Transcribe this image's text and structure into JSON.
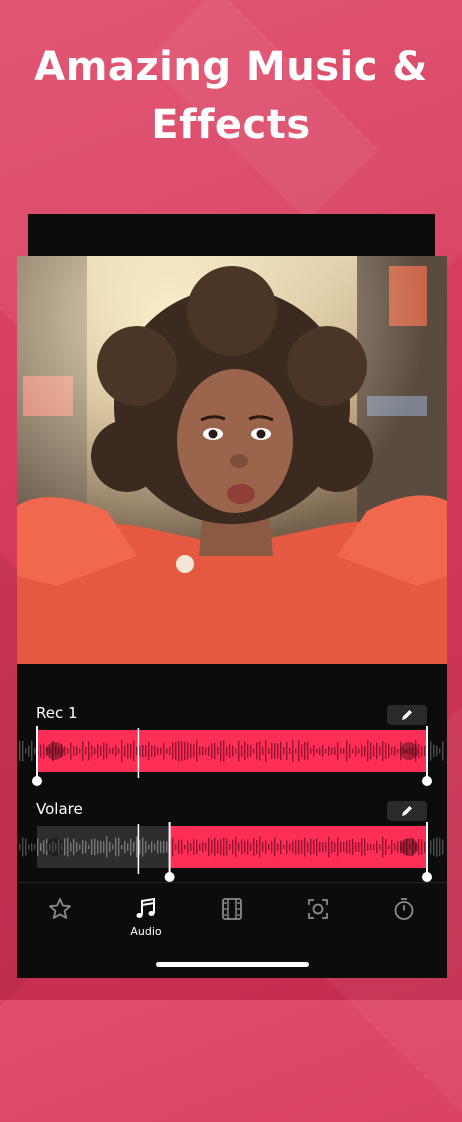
{
  "headline": {
    "line1": "Amazing Music &",
    "line2": "Effects"
  },
  "tracks": [
    {
      "name": "Rec 1",
      "selection_start": 0.0,
      "selection_end": 1.0,
      "playhead": 0.26
    },
    {
      "name": "Volare",
      "selection_start": 0.34,
      "selection_end": 1.0,
      "playhead": 0.26
    }
  ],
  "tabs": [
    {
      "icon": "star-icon",
      "label": ""
    },
    {
      "icon": "music-note-icon",
      "label": "Audio",
      "active": true
    },
    {
      "icon": "film-icon",
      "label": ""
    },
    {
      "icon": "scan-icon",
      "label": ""
    },
    {
      "icon": "timer-icon",
      "label": ""
    }
  ],
  "colors": {
    "background": "#d53a5c",
    "track_active": "#ff2e57",
    "track_dim": "#8e1630",
    "phone": "#0c0c0c"
  }
}
